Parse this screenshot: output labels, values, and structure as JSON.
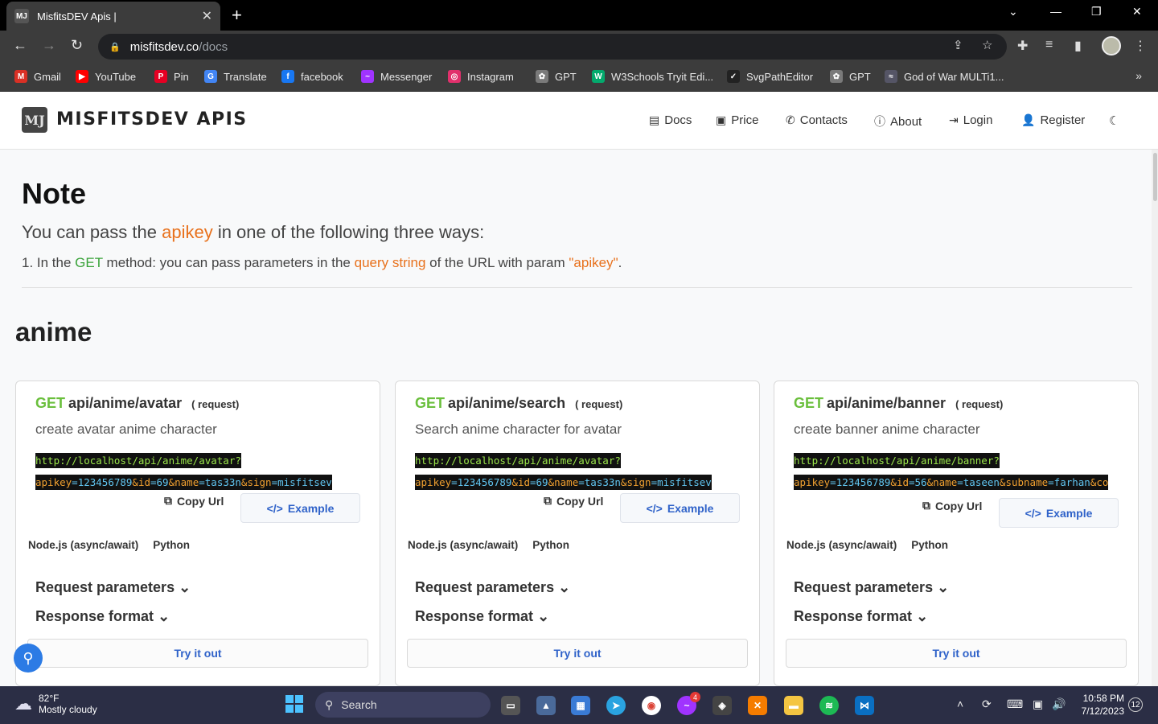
{
  "browser": {
    "tab_title": "MisfitsDEV Apis |",
    "tab_favicon": "MJ",
    "url_host": "misfitsdev.co",
    "url_path": "/docs",
    "bookmarks": [
      {
        "label": "Gmail",
        "icon": "gmail-icon",
        "color": "#d93025",
        "glyph": "M"
      },
      {
        "label": "YouTube",
        "icon": "youtube-icon",
        "color": "#ff0000",
        "glyph": "▶"
      },
      {
        "label": "Pin",
        "icon": "pinterest-icon",
        "color": "#e60023",
        "glyph": "P"
      },
      {
        "label": "Translate",
        "icon": "translate-icon",
        "color": "#4285f4",
        "glyph": "G"
      },
      {
        "label": "facebook",
        "icon": "facebook-icon",
        "color": "#1877f2",
        "glyph": "f"
      },
      {
        "label": "Messenger",
        "icon": "messenger-icon",
        "color": "#a033ff",
        "glyph": "~"
      },
      {
        "label": "Instagram",
        "icon": "instagram-icon",
        "color": "#e1306c",
        "glyph": "◎"
      },
      {
        "label": "GPT",
        "icon": "openai-icon",
        "color": "#7a7a7a",
        "glyph": "✿"
      },
      {
        "label": "W3Schools Tryit Edi...",
        "icon": "w3schools-icon",
        "color": "#04aa6d",
        "glyph": "W"
      },
      {
        "label": "SvgPathEditor",
        "icon": "svgpath-icon",
        "color": "#222222",
        "glyph": "✓"
      },
      {
        "label": "GPT",
        "icon": "openai-icon",
        "color": "#7a7a7a",
        "glyph": "✿"
      },
      {
        "label": "God of War MULTi1...",
        "icon": "gow-icon",
        "color": "#556",
        "glyph": "≈"
      }
    ],
    "more": "»"
  },
  "site": {
    "logo_glyph": "MJ",
    "brand": "MISFITSDEV APIS",
    "nav": [
      {
        "label": "Docs",
        "icon": "book-icon",
        "glyph": "▤"
      },
      {
        "label": "Price",
        "icon": "money-icon",
        "glyph": "▣"
      },
      {
        "label": "Contacts",
        "icon": "phone-icon",
        "glyph": "✆"
      },
      {
        "label": "About",
        "icon": "info-icon",
        "glyph": "ⓘ"
      },
      {
        "label": "Login",
        "icon": "login-icon",
        "glyph": "⇥"
      },
      {
        "label": "Register",
        "icon": "user-plus-icon",
        "glyph": "👤"
      }
    ],
    "theme_toggle": "☾"
  },
  "note": {
    "title": "Note",
    "sub_pre": "You can pass the ",
    "sub_key": "apikey",
    "sub_post": " in one of the following three ways:",
    "line_pre": "1. In the ",
    "line_get": "GET",
    "line_mid": " method: you can pass parameters in the ",
    "line_qs": "query string",
    "line_mid2": " of the URL with param ",
    "line_param": "\"apikey\"",
    "line_end": "."
  },
  "section": {
    "title": "anime"
  },
  "cards": [
    {
      "method": "GET",
      "path": "api/anime/avatar",
      "req": "( request)",
      "desc": "create avatar anime character",
      "url_base": "http://localhost/api/anime/avatar?",
      "url_params": [
        {
          "k": "apikey",
          "v": "123456789"
        },
        {
          "k": "&id",
          "v": "69"
        },
        {
          "k": "&name",
          "v": "tas33n"
        },
        {
          "k": "&sign",
          "v": "misfitsev"
        }
      ],
      "copy": "Copy Url",
      "example": "Example",
      "lang1": "Node.js (async/await)",
      "lang2": "Python",
      "req_params": "Request parameters",
      "resp_format": "Response format",
      "try": "Try it out"
    },
    {
      "method": "GET",
      "path": "api/anime/search",
      "req": "( request)",
      "desc": "Search anime character for avatar",
      "url_base": "http://localhost/api/anime/avatar?",
      "url_params": [
        {
          "k": "apikey",
          "v": "123456789"
        },
        {
          "k": "&id",
          "v": "69"
        },
        {
          "k": "&name",
          "v": "tas33n"
        },
        {
          "k": "&sign",
          "v": "misfitsev"
        }
      ],
      "copy": "Copy Url",
      "example": "Example",
      "lang1": "Node.js (async/await)",
      "lang2": "Python",
      "req_params": "Request parameters",
      "resp_format": "Response format",
      "try": "Try it out"
    },
    {
      "method": "GET",
      "path": "api/anime/banner",
      "req": "( request)",
      "desc": "create banner anime character",
      "url_base": "http://localhost/api/anime/banner?",
      "url_params": [
        {
          "k": "apikey",
          "v": "123456789"
        },
        {
          "k": "&id",
          "v": "56"
        },
        {
          "k": "&name",
          "v": "taseen"
        },
        {
          "k": "&subname",
          "v": "farhan"
        },
        {
          "k": "&co",
          "v": ""
        }
      ],
      "copy": "Copy Url",
      "example": "Example",
      "lang1": "Node.js (async/await)",
      "lang2": "Python",
      "req_params": "Request parameters",
      "resp_format": "Response format",
      "try": "Try it out"
    }
  ],
  "taskbar": {
    "temp": "82°F",
    "weather": "Mostly cloudy",
    "search": "Search",
    "time": "10:58 PM",
    "date": "7/12/2023",
    "notif_count": "12",
    "messenger_badge": "4"
  }
}
